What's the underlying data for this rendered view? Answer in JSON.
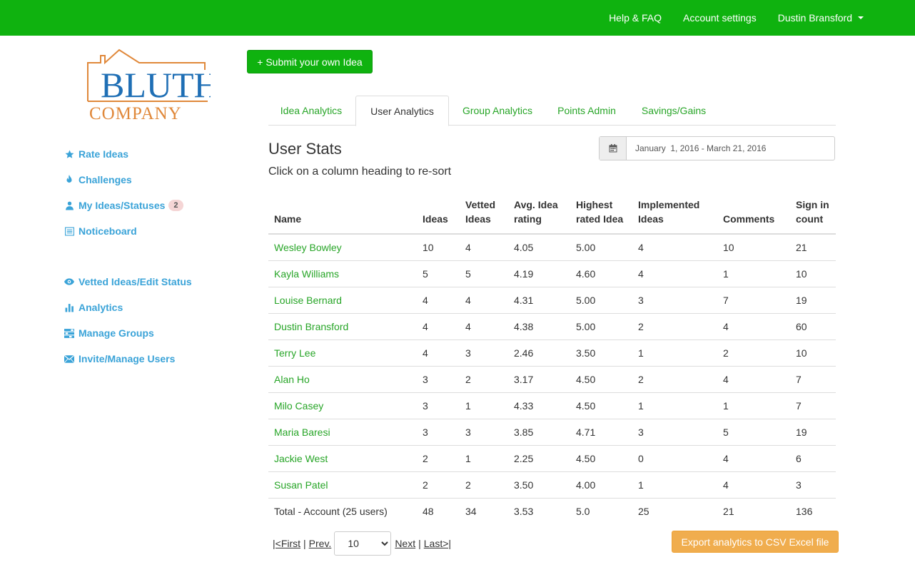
{
  "topnav": {
    "help": "Help & FAQ",
    "account": "Account settings",
    "user": "Dustin Bransford"
  },
  "logo": {
    "line1": "BLUTH",
    "line2": "COMPANY"
  },
  "sidebar": {
    "items": [
      {
        "label": "Rate Ideas",
        "icon": "star-icon"
      },
      {
        "label": "Challenges",
        "icon": "fire-icon"
      },
      {
        "label": "My Ideas/Statuses",
        "icon": "user-icon",
        "badge": "2"
      },
      {
        "label": "Noticeboard",
        "icon": "list-alt-icon"
      },
      {
        "label": "Vetted Ideas/Edit Status",
        "icon": "eye-icon"
      },
      {
        "label": "Analytics",
        "icon": "bar-chart-icon"
      },
      {
        "label": "Manage Groups",
        "icon": "tasks-icon"
      },
      {
        "label": "Invite/Manage Users",
        "icon": "envelope-icon"
      }
    ]
  },
  "submit_label": "+ Submit your own Idea",
  "tabs": [
    {
      "label": "Idea Analytics",
      "active": false
    },
    {
      "label": "User Analytics",
      "active": true
    },
    {
      "label": "Group Analytics",
      "active": false
    },
    {
      "label": "Points Admin",
      "active": false
    },
    {
      "label": "Savings/Gains",
      "active": false
    }
  ],
  "title": "User Stats",
  "subtitle": "Click on a column heading to re-sort",
  "daterange": "January  1, 2016 - March 21, 2016",
  "table": {
    "headers": [
      "Name",
      "Ideas",
      "Vetted Ideas",
      "Avg. Idea rating",
      "Highest rated Idea",
      "Implemented Ideas",
      "Comments",
      "Sign in count"
    ],
    "rows": [
      [
        "Wesley Bowley",
        "10",
        "4",
        "4.05",
        "5.00",
        "4",
        "10",
        "21"
      ],
      [
        "Kayla Williams",
        "5",
        "5",
        "4.19",
        "4.60",
        "4",
        "1",
        "10"
      ],
      [
        "Louise Bernard",
        "4",
        "4",
        "4.31",
        "5.00",
        "3",
        "7",
        "19"
      ],
      [
        "Dustin Bransford",
        "4",
        "4",
        "4.38",
        "5.00",
        "2",
        "4",
        "60"
      ],
      [
        "Terry Lee",
        "4",
        "3",
        "2.46",
        "3.50",
        "1",
        "2",
        "10"
      ],
      [
        "Alan Ho",
        "3",
        "2",
        "3.17",
        "4.50",
        "2",
        "4",
        "7"
      ],
      [
        "Milo Casey",
        "3",
        "1",
        "4.33",
        "4.50",
        "1",
        "1",
        "7"
      ],
      [
        "Maria Baresi",
        "3",
        "3",
        "3.85",
        "4.71",
        "3",
        "5",
        "19"
      ],
      [
        "Jackie West",
        "2",
        "1",
        "2.25",
        "4.50",
        "0",
        "4",
        "6"
      ],
      [
        "Susan Patel",
        "2",
        "2",
        "3.50",
        "4.00",
        "1",
        "4",
        "3"
      ]
    ],
    "total": [
      "Total - Account (25 users)",
      "48",
      "34",
      "3.53",
      "5.0",
      "25",
      "21",
      "136"
    ]
  },
  "pager": {
    "first": "|<First",
    "prev": "Prev.",
    "per_page": "10",
    "next": "Next",
    "last": "Last>|"
  },
  "export_label": "Export analytics to CSV Excel file",
  "colors": {
    "brand_green": "#0fb20f",
    "link_blue": "#3aa3d8",
    "export_orange": "#f0ad4e"
  }
}
